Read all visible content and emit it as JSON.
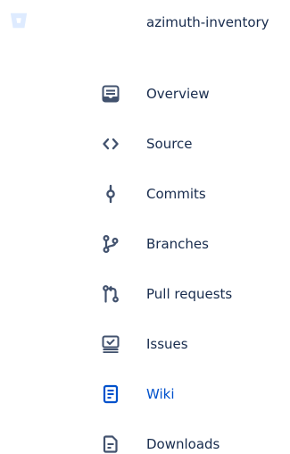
{
  "header": {
    "logo_icon": "bitbucket-logo-icon",
    "repo_name": "azimuth-inventory"
  },
  "colors": {
    "text": "#172b4d",
    "icon": "#42526e",
    "active": "#0052cc",
    "logo": "#deebff"
  },
  "nav": {
    "items": [
      {
        "label": "Overview",
        "icon": "overview-icon",
        "active": false
      },
      {
        "label": "Source",
        "icon": "source-code-icon",
        "active": false
      },
      {
        "label": "Commits",
        "icon": "commit-icon",
        "active": false
      },
      {
        "label": "Branches",
        "icon": "branch-icon",
        "active": false
      },
      {
        "label": "Pull requests",
        "icon": "pull-request-icon",
        "active": false
      },
      {
        "label": "Issues",
        "icon": "issues-icon",
        "active": false
      },
      {
        "label": "Wiki",
        "icon": "wiki-icon",
        "active": true
      },
      {
        "label": "Downloads",
        "icon": "downloads-icon",
        "active": false
      }
    ]
  }
}
